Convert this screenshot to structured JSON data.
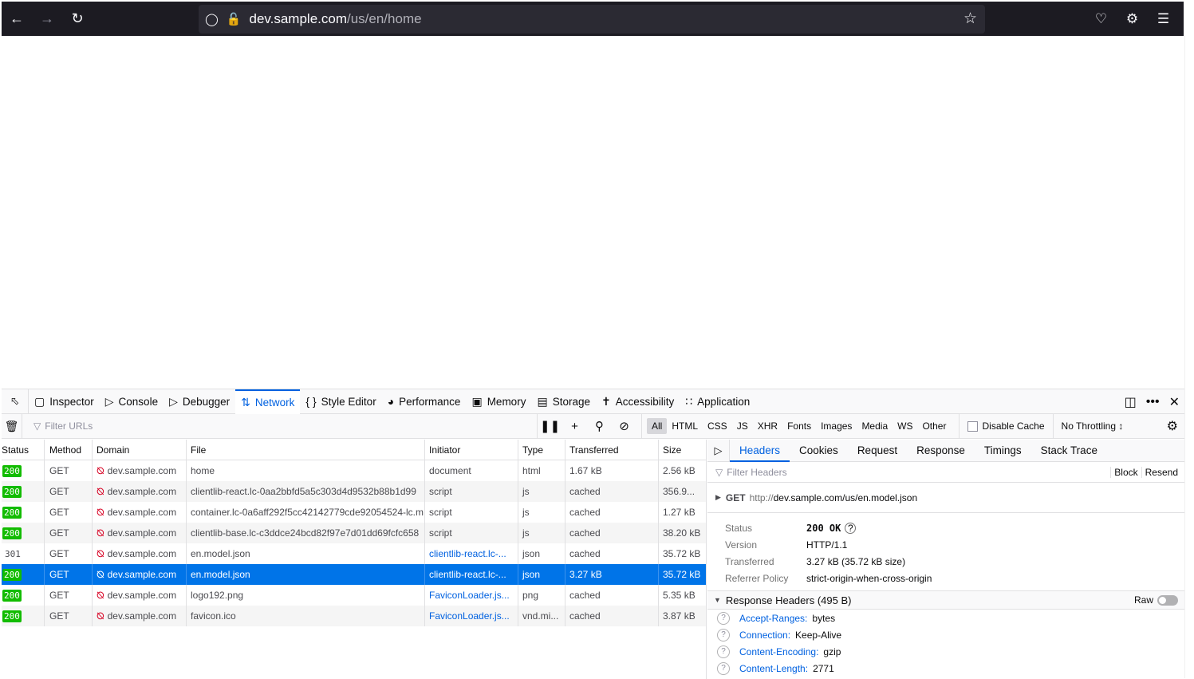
{
  "browser": {
    "url_host": "dev.sample.com",
    "url_path": "/us/en/home"
  },
  "devtools": {
    "tabs": [
      {
        "label": "Inspector",
        "icon": "inspector-icon"
      },
      {
        "label": "Console",
        "icon": "console-icon"
      },
      {
        "label": "Debugger",
        "icon": "debugger-icon"
      },
      {
        "label": "Network",
        "icon": "network-icon"
      },
      {
        "label": "Style Editor",
        "icon": "braces-icon"
      },
      {
        "label": "Performance",
        "icon": "gauge-icon"
      },
      {
        "label": "Memory",
        "icon": "memory-icon"
      },
      {
        "label": "Storage",
        "icon": "storage-icon"
      },
      {
        "label": "Accessibility",
        "icon": "accessibility-icon"
      },
      {
        "label": "Application",
        "icon": "grid-icon"
      }
    ],
    "active_tab": "Network",
    "toolbar": {
      "filter_placeholder": "Filter URLs",
      "type_filters": [
        "All",
        "HTML",
        "CSS",
        "JS",
        "XHR",
        "Fonts",
        "Images",
        "Media",
        "WS",
        "Other"
      ],
      "active_filter": "All",
      "disable_cache": "Disable Cache",
      "throttling": "No Throttling ↕"
    },
    "columns": [
      "Status",
      "Method",
      "Domain",
      "File",
      "Initiator",
      "Type",
      "Transferred",
      "Size"
    ],
    "requests": [
      {
        "status": "200",
        "method": "GET",
        "domain": "dev.sample.com",
        "file": "home",
        "initiator": "document",
        "initiator_link": false,
        "type": "html",
        "transferred": "1.67 kB",
        "size": "2.56 kB"
      },
      {
        "status": "200",
        "method": "GET",
        "domain": "dev.sample.com",
        "file": "clientlib-react.lc-0aa2bbfd5a5c303d4d9532b88b1d99",
        "initiator": "script",
        "initiator_link": false,
        "type": "js",
        "transferred": "cached",
        "size": "356.9..."
      },
      {
        "status": "200",
        "method": "GET",
        "domain": "dev.sample.com",
        "file": "container.lc-0a6aff292f5cc42142779cde92054524-lc.m",
        "initiator": "script",
        "initiator_link": false,
        "type": "js",
        "transferred": "cached",
        "size": "1.27 kB"
      },
      {
        "status": "200",
        "method": "GET",
        "domain": "dev.sample.com",
        "file": "clientlib-base.lc-c3ddce24bcd82f97e7d01dd69fcfc658",
        "initiator": "script",
        "initiator_link": false,
        "type": "js",
        "transferred": "cached",
        "size": "38.20 kB"
      },
      {
        "status": "301",
        "method": "GET",
        "domain": "dev.sample.com",
        "file": "en.model.json",
        "initiator": "clientlib-react.lc-...",
        "initiator_link": true,
        "type": "json",
        "transferred": "cached",
        "size": "35.72 kB"
      },
      {
        "status": "200",
        "method": "GET",
        "domain": "dev.sample.com",
        "file": "en.model.json",
        "initiator": "clientlib-react.lc-...",
        "initiator_link": true,
        "type": "json",
        "transferred": "3.27 kB",
        "size": "35.72 kB",
        "selected": true
      },
      {
        "status": "200",
        "method": "GET",
        "domain": "dev.sample.com",
        "file": "logo192.png",
        "initiator": "FaviconLoader.js...",
        "initiator_link": true,
        "type": "png",
        "transferred": "cached",
        "size": "5.35 kB"
      },
      {
        "status": "200",
        "method": "GET",
        "domain": "dev.sample.com",
        "file": "favicon.ico",
        "initiator": "FaviconLoader.js...",
        "initiator_link": true,
        "type": "vnd.mi...",
        "transferred": "cached",
        "size": "3.87 kB"
      }
    ],
    "details": {
      "tabs": [
        "Headers",
        "Cookies",
        "Request",
        "Response",
        "Timings",
        "Stack Trace"
      ],
      "active_tab": "Headers",
      "filter_placeholder": "Filter Headers",
      "block": "Block",
      "resend": "Resend",
      "method": "GET",
      "url_scheme": "http://",
      "url_rest": "dev.sample.com/us/en.model.json",
      "fields": [
        {
          "key": "Status",
          "value": "200 OK"
        },
        {
          "key": "Version",
          "value": "HTTP/1.1"
        },
        {
          "key": "Transferred",
          "value": "3.27 kB (35.72 kB size)"
        },
        {
          "key": "Referrer Policy",
          "value": "strict-origin-when-cross-origin"
        }
      ],
      "response_headers_title": "Response Headers (495 B)",
      "raw_label": "Raw",
      "headers": [
        {
          "name": "Accept-Ranges:",
          "value": "bytes"
        },
        {
          "name": "Connection:",
          "value": "Keep-Alive"
        },
        {
          "name": "Content-Encoding:",
          "value": "gzip"
        },
        {
          "name": "Content-Length:",
          "value": "2771"
        }
      ]
    }
  }
}
